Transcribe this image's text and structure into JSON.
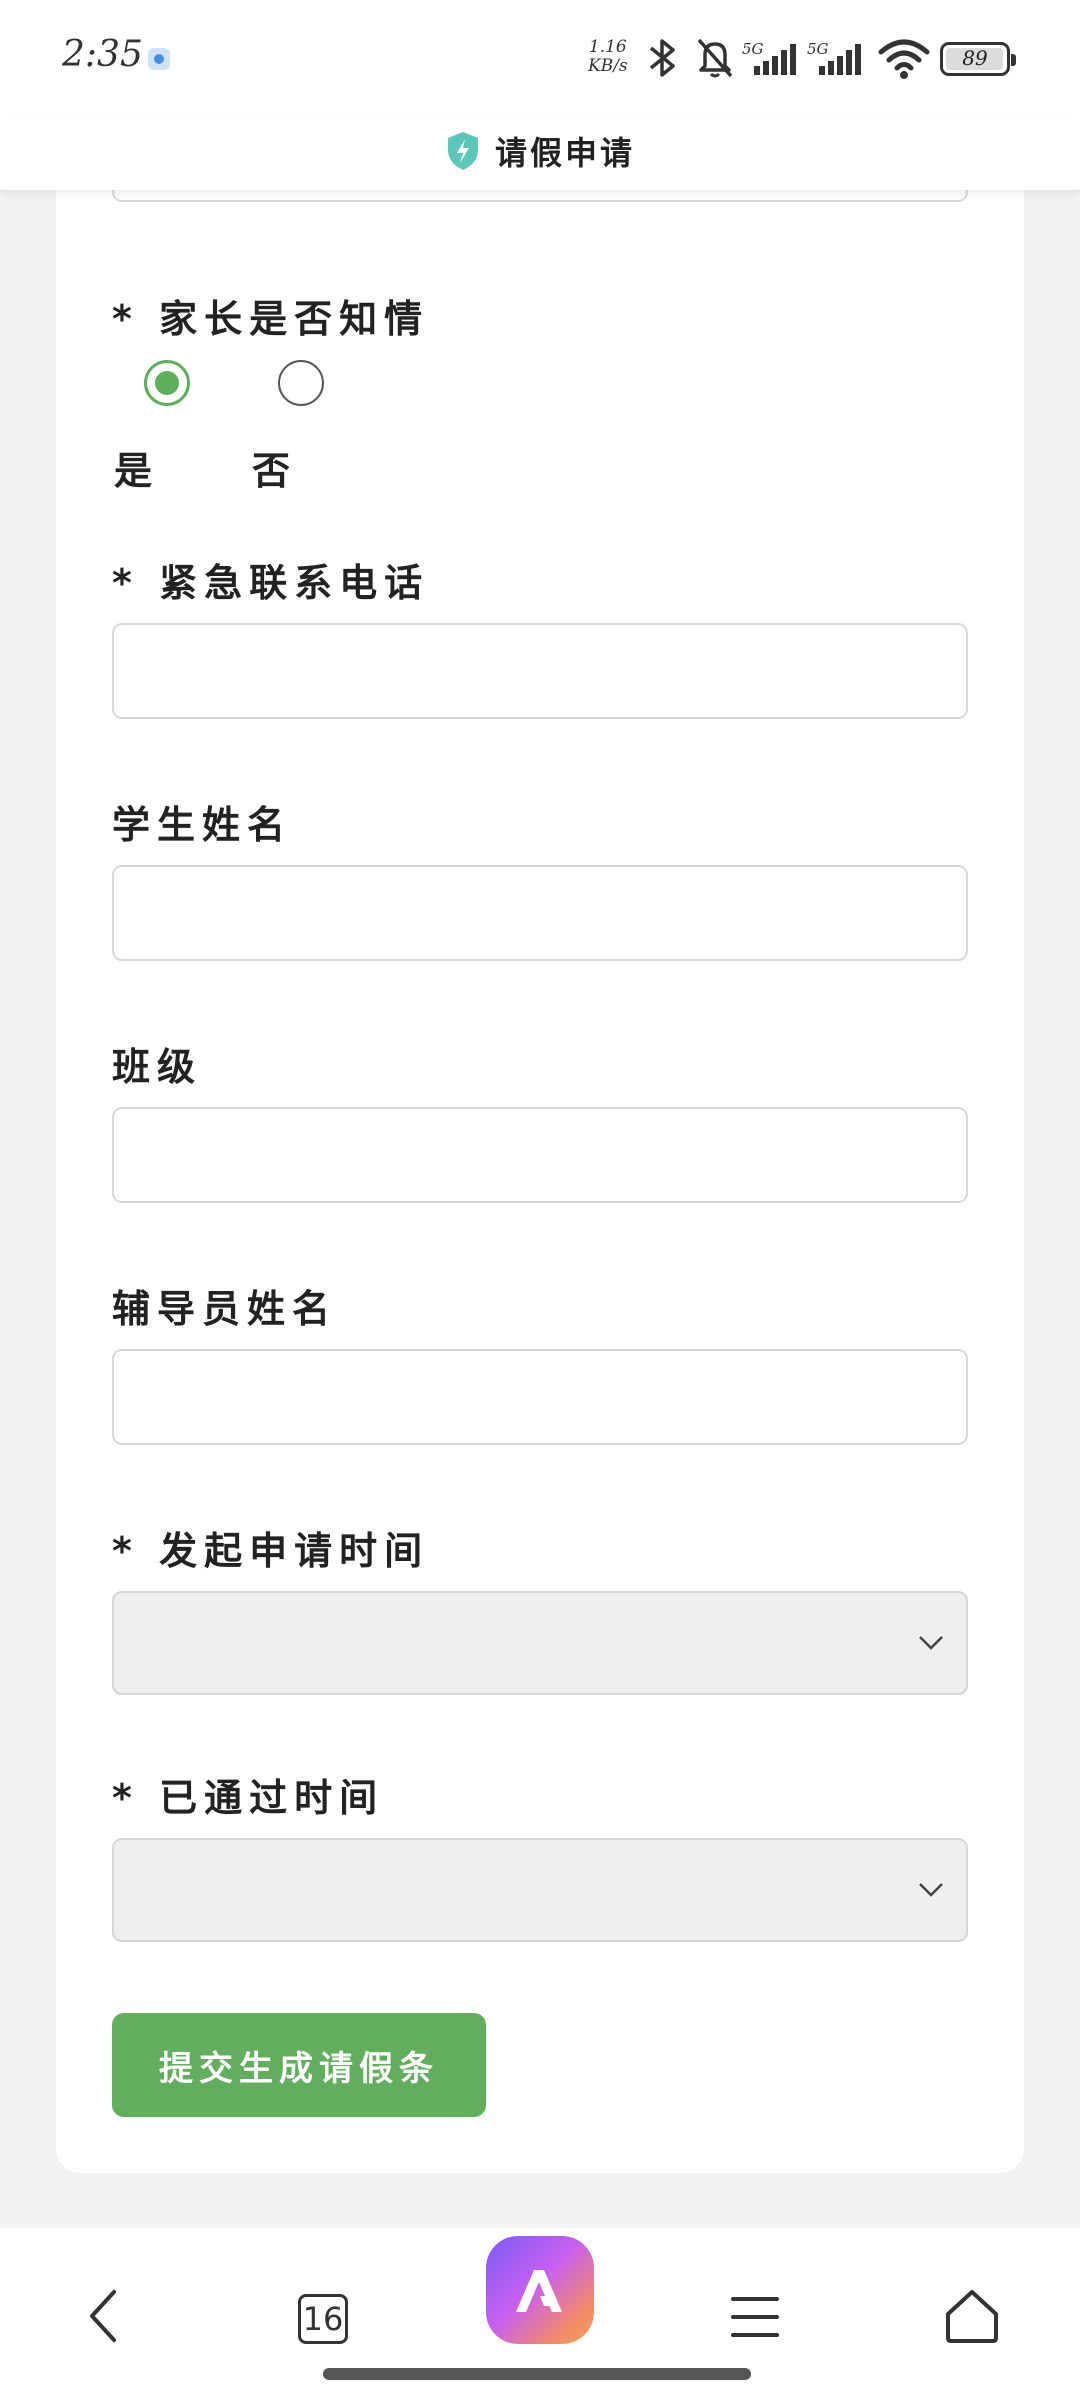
{
  "status_bar": {
    "time": "2:35",
    "speed_top": "1.16",
    "speed_bottom": "KB/s",
    "network_1": "5G",
    "network_2": "5G",
    "battery": "89"
  },
  "header": {
    "title": "请假申请"
  },
  "form": {
    "parent_informed": {
      "label": "* 家长是否知情",
      "options": [
        "是",
        "否"
      ],
      "selected": "是"
    },
    "emergency_phone": {
      "label": "* 紧急联系电话",
      "value": ""
    },
    "student_name": {
      "label": "学生姓名",
      "value": ""
    },
    "class": {
      "label": "班级",
      "value": ""
    },
    "counselor_name": {
      "label": "辅导员姓名",
      "value": ""
    },
    "apply_time": {
      "label": "* 发起申请时间",
      "value": ""
    },
    "passed_time": {
      "label": "* 已通过时间",
      "value": ""
    },
    "submit_label": "提交生成请假条"
  },
  "bottom_nav": {
    "tab_count": "16"
  },
  "colors": {
    "accent_green": "#63ad5f",
    "title_shield": "#5cc6b8"
  }
}
